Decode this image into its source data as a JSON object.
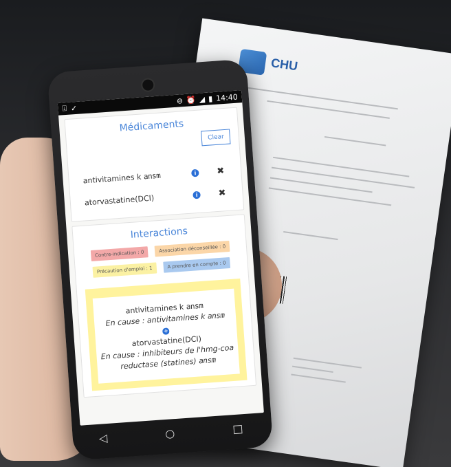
{
  "background": {
    "paper_logo_text": "CHU"
  },
  "statusbar": {
    "time": "14:40",
    "left_icons": [
      "download-icon",
      "check-icon"
    ],
    "right_icons": [
      "dnd-icon",
      "alarm-icon",
      "signal-icon",
      "battery-icon"
    ]
  },
  "medicaments": {
    "title": "Médicaments",
    "clear_label": "Clear",
    "items": [
      {
        "name": "antivitamines k",
        "suffix": "ansm"
      },
      {
        "name": "atorvastatine(DCI)",
        "suffix": ""
      }
    ]
  },
  "interactions": {
    "title": "Interactions",
    "badges": [
      {
        "label": "Contre-indication : 0",
        "color": "#f3a8a8"
      },
      {
        "label": "Association déconseillée : 0",
        "color": "#fbd6a8"
      },
      {
        "label": "Précaution d'emploi : 1",
        "color": "#fbf1a3"
      },
      {
        "label": "A prendre en compte : 0",
        "color": "#a9c9ef"
      }
    ],
    "detail": {
      "drug1": "antivitamines k",
      "drug1_suffix": "ansm",
      "cause1": "En cause : antivitamines k",
      "cause1_suffix": "ansm",
      "drug2": "atorvastatine(DCI)",
      "cause2": "En cause : inhibiteurs de l'hmg-coa reductase (statines)",
      "cause2_suffix": "ansm"
    }
  },
  "navbar": {
    "back": "◁",
    "home": "○",
    "recents": "□"
  },
  "colors": {
    "accent": "#4a86d9",
    "info": "#2a6fd6",
    "detail_bg": "#fff39d"
  }
}
